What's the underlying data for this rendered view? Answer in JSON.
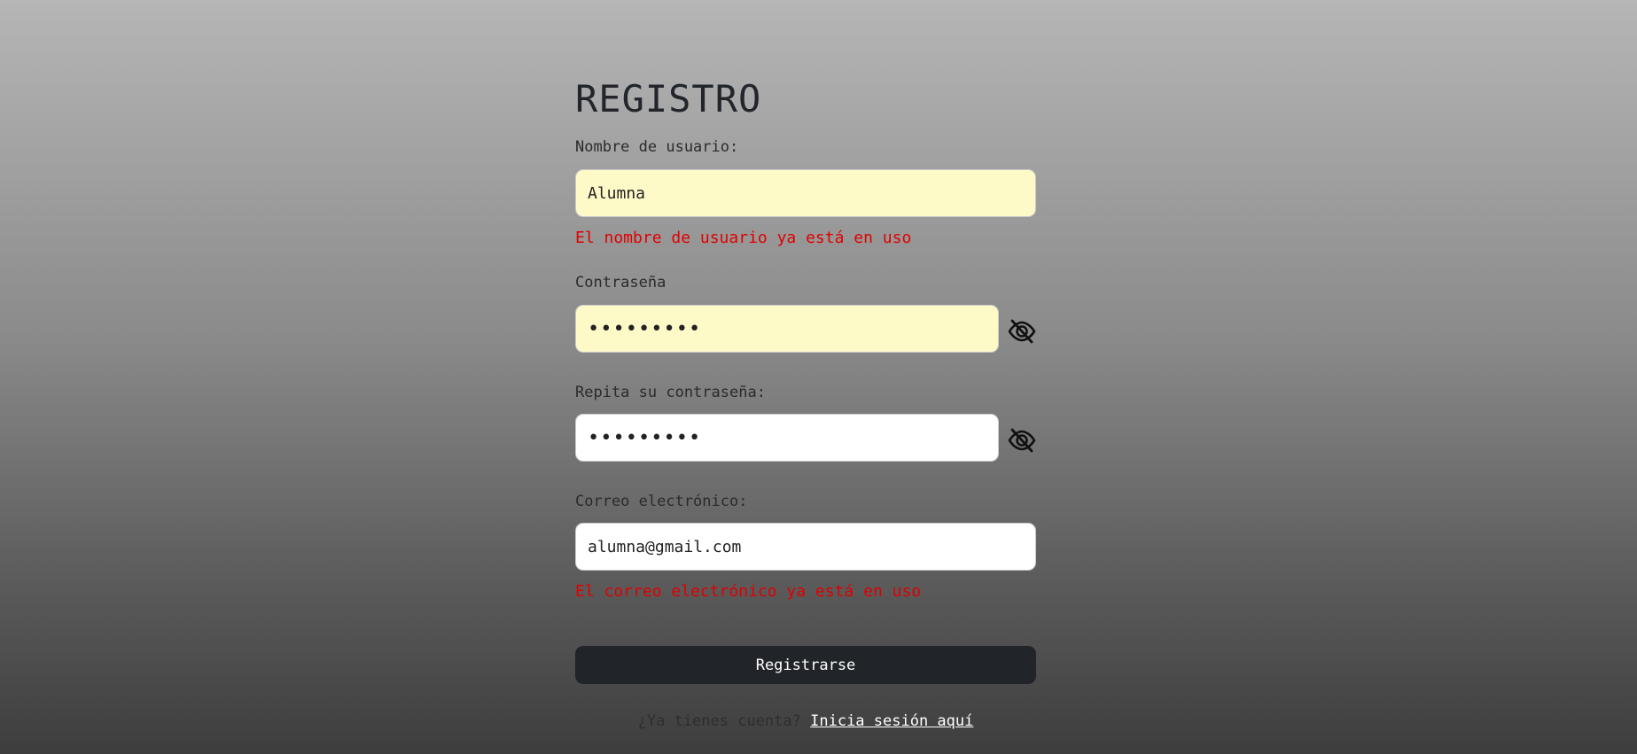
{
  "form": {
    "title": "REGISTRO",
    "username": {
      "label": "Nombre de usuario:",
      "value": "Alumna",
      "error": "El nombre de usuario ya está en uso"
    },
    "password": {
      "label": "Contraseña",
      "value": "•••••••••",
      "toggle_icon": "eye-slash-icon"
    },
    "password_repeat": {
      "label": "Repita su contraseña:",
      "value": "•••••••••",
      "toggle_icon": "eye-slash-icon"
    },
    "email": {
      "label": "Correo electrónico:",
      "value": "alumna@gmail.com",
      "error": "El correo electrónico ya está en uso"
    },
    "submit_label": "Registrarse",
    "footer": {
      "question": "¿Ya tienes cuenta?",
      "link": "Inicia sesión aquí"
    }
  },
  "colors": {
    "autofill_bg": "#fefac8",
    "error": "#e00000",
    "button_bg": "#212429",
    "link": "#ffffff"
  }
}
